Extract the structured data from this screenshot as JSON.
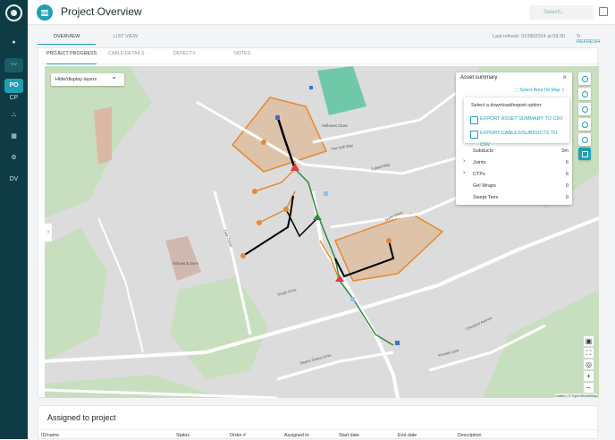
{
  "sidebar": {
    "logo_icon": "fiber-logo-icon",
    "items": [
      {
        "icon": "map-pin-icon"
      },
      {
        "icon": "trend-chart-icon"
      },
      {
        "label": "PO"
      },
      {
        "label": "CP"
      },
      {
        "icon": "network-icon"
      },
      {
        "icon": "map-icon"
      },
      {
        "icon": "gear-icon"
      },
      {
        "label": "DV"
      }
    ]
  },
  "header": {
    "title": "Project Overview",
    "search_placeholder": "Search...",
    "accent": "#1ea0b4"
  },
  "tabs": {
    "overview": "OVERVIEW",
    "list_view": "LIST VIEW",
    "last_refresh": "Last refresh: 01/08/2024 at 09:30",
    "refresh": "REFRESH"
  },
  "subtabs": {
    "progress": "PROJECT PROGRESS",
    "cable": "CABLE DETAILS",
    "defects": "DEFECTS",
    "notes": "NOTES"
  },
  "map": {
    "layers_button": "Hide/display layers",
    "attribution": "Leaflet | © OpenStreetMap",
    "labels": {
      "hallowes": "Hallowes Close",
      "hall_way": "The Hall Way",
      "fyfield": "Fyfield Way",
      "south": "South Drive",
      "north": "North Drive",
      "dale": "Dale Close",
      "chestnut": "Chestnut Avenue",
      "kennel": "Kennel Lane",
      "deane": "Deane Green Drive",
      "holmes": "Holmes & Sons"
    }
  },
  "asset_summary": {
    "title": "Asset summary",
    "select_area": "Select Area On Map",
    "export_title": "Select a download/export option:",
    "export_summary": "EXPORT ASSET SUMMARY TO CSV",
    "export_cables": "EXPORT CABLES/SUBDUCTS TO CSV",
    "rows": [
      {
        "label": "Subducts",
        "value": "0m"
      },
      {
        "label": "Joints",
        "value": "6"
      },
      {
        "label": "CTPs",
        "value": "6"
      },
      {
        "label": "Gel Wraps",
        "value": "0"
      },
      {
        "label": "Swept Tees",
        "value": "0"
      }
    ]
  },
  "assigned": {
    "title": "Assigned to project",
    "columns": [
      "ID/name",
      "Status",
      "Order #",
      "Assigned to",
      "Start date",
      "End date",
      "Description"
    ]
  }
}
